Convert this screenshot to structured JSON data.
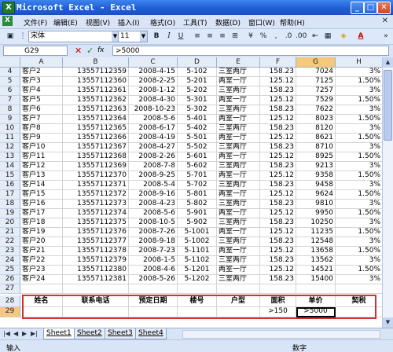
{
  "window": {
    "title": "Microsoft Excel - Excel",
    "app_icon": "X"
  },
  "menu": [
    "文件(F)",
    "编辑(E)",
    "视图(V)",
    "插入(I)",
    "格式(O)",
    "工具(T)",
    "数据(D)",
    "窗口(W)",
    "帮助(H)"
  ],
  "toolbar": {
    "font_name": "宋体",
    "font_size": "11",
    "bold": "B",
    "italic": "I",
    "underline": "U",
    "percent": "%",
    "comma": ",",
    "font_color": "A"
  },
  "formula_bar": {
    "name_box": "G29",
    "cancel": "✕",
    "confirm": "✓",
    "fx": "fx",
    "formula": ">5000"
  },
  "columns": [
    "A",
    "B",
    "C",
    "D",
    "E",
    "F",
    "G",
    "H"
  ],
  "rows": [
    {
      "n": "4",
      "name": "客户2",
      "phone": "13557112359",
      "date": "2008-4-15",
      "room": "5-102",
      "type": "三室两厅",
      "area": "158.23",
      "price": "7024",
      "tax": "3%"
    },
    {
      "n": "5",
      "name": "客户3",
      "phone": "13557112360",
      "date": "2008-2-25",
      "room": "5-201",
      "type": "两室一厅",
      "area": "125.12",
      "price": "7125",
      "tax": "1.50%"
    },
    {
      "n": "6",
      "name": "客户4",
      "phone": "13557112361",
      "date": "2008-1-12",
      "room": "5-202",
      "type": "三室两厅",
      "area": "158.23",
      "price": "7257",
      "tax": "3%"
    },
    {
      "n": "7",
      "name": "客户5",
      "phone": "13557112362",
      "date": "2008-4-30",
      "room": "5-301",
      "type": "两室一厅",
      "area": "125.12",
      "price": "7529",
      "tax": "1.50%"
    },
    {
      "n": "8",
      "name": "客户6",
      "phone": "13557112363",
      "date": "2008-10-23",
      "room": "5-302",
      "type": "三室两厅",
      "area": "158.23",
      "price": "7622",
      "tax": "3%"
    },
    {
      "n": "9",
      "name": "客户7",
      "phone": "13557112364",
      "date": "2008-5-6",
      "room": "5-401",
      "type": "两室一厅",
      "area": "125.12",
      "price": "8023",
      "tax": "1.50%"
    },
    {
      "n": "10",
      "name": "客户8",
      "phone": "13557112365",
      "date": "2008-6-17",
      "room": "5-402",
      "type": "三室两厅",
      "area": "158.23",
      "price": "8120",
      "tax": "3%"
    },
    {
      "n": "11",
      "name": "客户9",
      "phone": "13557112366",
      "date": "2008-4-19",
      "room": "5-501",
      "type": "两室一厅",
      "area": "125.12",
      "price": "8621",
      "tax": "1.50%"
    },
    {
      "n": "12",
      "name": "客户10",
      "phone": "13557112367",
      "date": "2008-4-27",
      "room": "5-502",
      "type": "三室两厅",
      "area": "158.23",
      "price": "8710",
      "tax": "3%"
    },
    {
      "n": "13",
      "name": "客户11",
      "phone": "13557112368",
      "date": "2008-2-26",
      "room": "5-601",
      "type": "两室一厅",
      "area": "125.12",
      "price": "8925",
      "tax": "1.50%"
    },
    {
      "n": "14",
      "name": "客户12",
      "phone": "13557112369",
      "date": "2008-7-8",
      "room": "5-602",
      "type": "三室两厅",
      "area": "158.23",
      "price": "9213",
      "tax": "3%"
    },
    {
      "n": "15",
      "name": "客户13",
      "phone": "13557112370",
      "date": "2008-9-25",
      "room": "5-701",
      "type": "两室一厅",
      "area": "125.12",
      "price": "9358",
      "tax": "1.50%"
    },
    {
      "n": "16",
      "name": "客户14",
      "phone": "13557112371",
      "date": "2008-5-4",
      "room": "5-702",
      "type": "三室两厅",
      "area": "158.23",
      "price": "9458",
      "tax": "3%"
    },
    {
      "n": "17",
      "name": "客户15",
      "phone": "13557112372",
      "date": "2008-9-16",
      "room": "5-801",
      "type": "两室一厅",
      "area": "125.12",
      "price": "9624",
      "tax": "1.50%"
    },
    {
      "n": "18",
      "name": "客户16",
      "phone": "13557112373",
      "date": "2008-4-23",
      "room": "5-802",
      "type": "三室两厅",
      "area": "158.23",
      "price": "9810",
      "tax": "3%"
    },
    {
      "n": "19",
      "name": "客户17",
      "phone": "13557112374",
      "date": "2008-5-6",
      "room": "5-901",
      "type": "两室一厅",
      "area": "125.12",
      "price": "9950",
      "tax": "1.50%"
    },
    {
      "n": "20",
      "name": "客户18",
      "phone": "13557112375",
      "date": "2008-10-5",
      "room": "5-902",
      "type": "三室两厅",
      "area": "158.23",
      "price": "10250",
      "tax": "3%"
    },
    {
      "n": "21",
      "name": "客户19",
      "phone": "13557112376",
      "date": "2008-7-26",
      "room": "5-1001",
      "type": "两室一厅",
      "area": "125.12",
      "price": "11235",
      "tax": "1.50%"
    },
    {
      "n": "22",
      "name": "客户20",
      "phone": "13557112377",
      "date": "2008-9-18",
      "room": "5-1002",
      "type": "三室两厅",
      "area": "158.23",
      "price": "12548",
      "tax": "3%"
    },
    {
      "n": "23",
      "name": "客户21",
      "phone": "13557112378",
      "date": "2008-7-23",
      "room": "5-1101",
      "type": "两室一厅",
      "area": "125.12",
      "price": "13658",
      "tax": "1.50%"
    },
    {
      "n": "24",
      "name": "客户22",
      "phone": "13557112379",
      "date": "2008-1-5",
      "room": "5-1102",
      "type": "三室两厅",
      "area": "158.23",
      "price": "13562",
      "tax": "3%"
    },
    {
      "n": "25",
      "name": "客户23",
      "phone": "13557112380",
      "date": "2008-4-6",
      "room": "5-1201",
      "type": "两室一厅",
      "area": "125.12",
      "price": "14521",
      "tax": "1.50%"
    },
    {
      "n": "26",
      "name": "客户24",
      "phone": "13557112381",
      "date": "2008-5-26",
      "room": "5-1202",
      "type": "三室两厅",
      "area": "158.23",
      "price": "15400",
      "tax": "3%"
    },
    {
      "n": "27",
      "name": "",
      "phone": "",
      "date": "",
      "room": "",
      "type": "",
      "area": "",
      "price": "",
      "tax": ""
    }
  ],
  "criteria": {
    "header_row": "28",
    "value_row": "29",
    "headers": [
      "姓名",
      "联系电话",
      "预定日期",
      "楼号",
      "户型",
      "面积",
      "单价",
      "契税"
    ],
    "values": [
      "",
      "",
      "",
      "",
      "",
      ">150",
      ">5000",
      ""
    ]
  },
  "sheet_tabs": [
    "Sheet1",
    "Sheet2",
    "Sheet3",
    "Sheet4"
  ],
  "status": {
    "left": "输入",
    "mode": "数字"
  }
}
